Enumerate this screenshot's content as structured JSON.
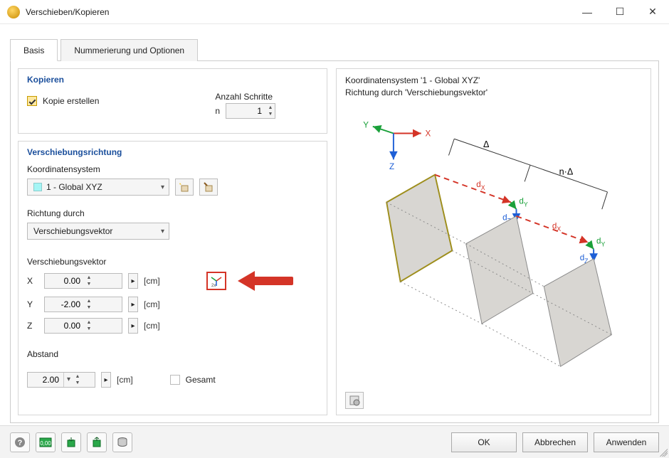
{
  "window": {
    "title": "Verschieben/Kopieren",
    "buttons": {
      "min": "—",
      "max": "☐",
      "close": "✕"
    }
  },
  "tabs": {
    "basis": "Basis",
    "numbering": "Nummerierung und Optionen",
    "active": "basis"
  },
  "groups": {
    "copy": {
      "title": "Kopieren",
      "create_copy_label": "Kopie erstellen",
      "create_copy_checked": true,
      "steps_label": "Anzahl Schritte",
      "n_label": "n",
      "n_value": "1"
    },
    "direction": {
      "title": "Verschiebungsrichtung",
      "coord_label": "Koordinatensystem",
      "coord_value": "1 - Global XYZ",
      "richtung_label": "Richtung durch",
      "richtung_value": "Verschiebungsvektor",
      "vector_label": "Verschiebungsvektor",
      "x_label": "X",
      "x_value": "0.00",
      "y_label": "Y",
      "y_value": "-2.00",
      "z_label": "Z",
      "z_value": "0.00",
      "unit": "[cm]",
      "abstand_label": "Abstand",
      "abstand_value": "2.00",
      "gesamt_label": "Gesamt"
    }
  },
  "preview": {
    "line1": "Koordinatensystem '1 - Global XYZ'",
    "line2": "Richtung durch 'Verschiebungsvektor'",
    "axes": {
      "x": "X",
      "y": "Y",
      "z": "Z"
    },
    "labels": {
      "delta": "Δ",
      "ndelta": "n·Δ",
      "dx": "d",
      "dxsub": "X",
      "dy": "d",
      "dysub": "Y",
      "dz": "d",
      "dzsub": "Z"
    }
  },
  "footer": {
    "ok": "OK",
    "cancel": "Abbrechen",
    "apply": "Anwenden"
  }
}
